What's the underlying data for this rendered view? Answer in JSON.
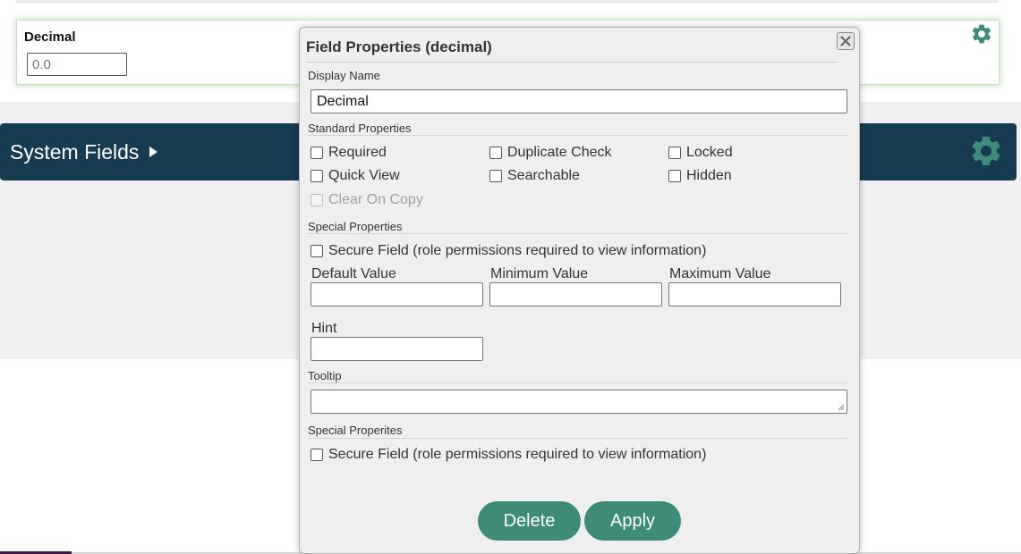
{
  "background_form": {
    "field_label": "Decimal",
    "field_placeholder": "0.0",
    "system_section_title": "System Fields",
    "gear_icon": "gear-icon",
    "accent_color": "#173b50",
    "gear_color": "#3e8b78"
  },
  "modal": {
    "title": "Field Properties (decimal)",
    "close_icon": "close-icon",
    "display_name_label": "Display Name",
    "display_name_value": "Decimal",
    "standard_properties_label": "Standard Properties",
    "standard_properties": [
      {
        "label": "Required",
        "checked": false
      },
      {
        "label": "Duplicate Check",
        "checked": false
      },
      {
        "label": "Locked",
        "checked": false
      },
      {
        "label": "Quick View",
        "checked": false
      },
      {
        "label": "Searchable",
        "checked": false
      },
      {
        "label": "Hidden",
        "checked": false
      },
      {
        "label": "Clear On Copy",
        "checked": false,
        "disabled": true
      }
    ],
    "special_properties_label": "Special Properties",
    "secure_field_label": "Secure Field (role permissions required to view information)",
    "default_value_label": "Default Value",
    "default_value": "",
    "minimum_value_label": "Minimum Value",
    "minimum_value": "",
    "maximum_value_label": "Maximum Value",
    "maximum_value": "",
    "hint_label": "Hint",
    "hint_value": "",
    "tooltip_label": "Tooltip",
    "tooltip_value": "",
    "special_properites_label": "Special Properites",
    "secure_field_label_2": "Secure Field (role permissions required to view information)",
    "delete_label": "Delete",
    "apply_label": "Apply",
    "button_color": "#3e8b78"
  }
}
